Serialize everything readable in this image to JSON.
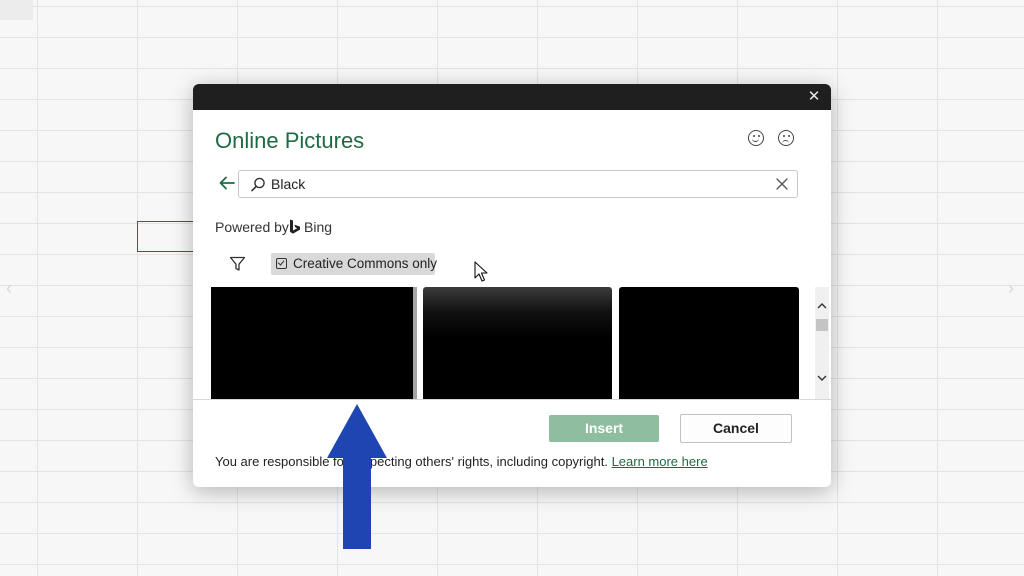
{
  "dialog": {
    "title": "Online Pictures",
    "close_glyph": "✕"
  },
  "search": {
    "value": "Black"
  },
  "powered_by": {
    "label": "Powered by",
    "brand": "Bing"
  },
  "filter": {
    "creative_commons_label": "Creative Commons only",
    "creative_commons_checked": true
  },
  "results": {
    "thumbnails": [
      "black-image",
      "black-image",
      "black-image"
    ]
  },
  "buttons": {
    "insert": "Insert",
    "cancel": "Cancel"
  },
  "footer": {
    "rights_text": "You are responsible for respecting others' rights, including copyright. ",
    "learn_more": "Learn more here"
  },
  "colors": {
    "accent": "#1e6b43",
    "insert_disabled": "#8fbd9f",
    "annotation_arrow": "#1f45b3"
  },
  "icons": [
    "close-icon",
    "smile-icon",
    "frown-icon",
    "back-arrow-icon",
    "search-icon",
    "clear-icon",
    "bing-logo-icon",
    "filter-icon",
    "checkbox-icon",
    "mouse-cursor-icon",
    "scroll-up-icon",
    "scroll-down-icon",
    "up-arrow-annotation-icon"
  ]
}
